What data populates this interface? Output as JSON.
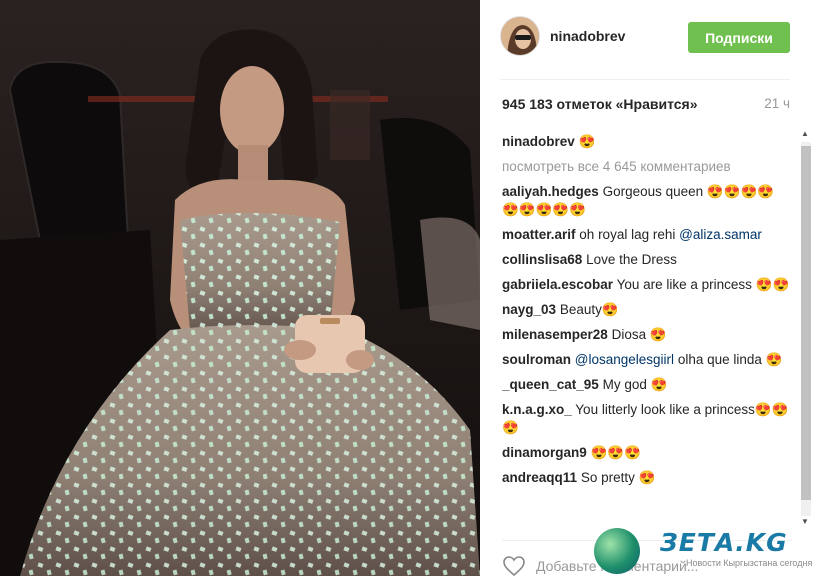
{
  "post": {
    "username": "ninadobrev",
    "follow_label": "Подписки",
    "likes": "945 183 отметок «Нравится»",
    "time": "21 ч",
    "caption_emoji": "😍",
    "view_all": "посмотреть все 4 645 комментариев",
    "add_comment_placeholder": "Добавьте комментарий..."
  },
  "comments": [
    {
      "user": "aaliyah.hedges",
      "text": "Gorgeous queen 😍😍😍😍 😍😍😍😍😍"
    },
    {
      "user": "moatter.arif",
      "text": "oh royal lag rehi",
      "mention": "@aliza.samar"
    },
    {
      "user": "collinslisa68",
      "text": "Love the Dress"
    },
    {
      "user": "gabriiela.escobar",
      "text": "You are like a princess 😍😍"
    },
    {
      "user": "nayg_03",
      "text": "Beauty😍"
    },
    {
      "user": "milenasemper28",
      "text": "Diosa 😍"
    },
    {
      "user": "soulroman",
      "mention": "@losangelesgiirl",
      "text": "olha que linda 😍"
    },
    {
      "user": "_queen_cat_95",
      "text": "My god 😍"
    },
    {
      "user": "k.n.a.g.xo_",
      "text": "You litterly look like a princess😍😍😍"
    },
    {
      "user": "dinamorgan9",
      "text": "😍😍😍"
    },
    {
      "user": "andreaqq11",
      "text": "So pretty 😍"
    }
  ],
  "icons": {
    "heart": "heart-icon",
    "scroll_up": "arrow-up-icon",
    "scroll_down": "arrow-down-icon"
  },
  "watermark": {
    "brand": "ЗЕТА.KG",
    "tagline": "Новости Кыргызстана сегодня"
  },
  "colors": {
    "follow_green": "#70c050",
    "mention_blue": "#003569",
    "muted_gray": "#999999"
  }
}
